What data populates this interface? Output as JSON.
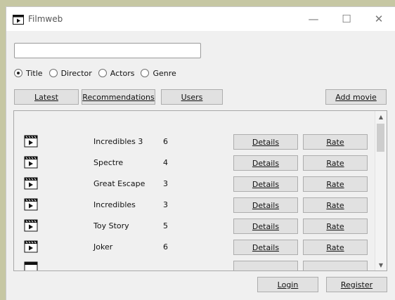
{
  "window": {
    "title": "Filmweb",
    "controls": {
      "minimize": "—",
      "maximize": "☐",
      "close": "✕"
    }
  },
  "search": {
    "value": "",
    "placeholder": ""
  },
  "filters": {
    "options": [
      "Title",
      "Director",
      "Actors",
      "Genre"
    ],
    "selected": "Title"
  },
  "toolbar": {
    "latest": "Latest",
    "recommendations": "Recommendations",
    "users": "Users",
    "add_movie": "Add movie"
  },
  "movies": [
    {
      "title": "Incredibles 3",
      "rating": "6"
    },
    {
      "title": "Spectre",
      "rating": "4"
    },
    {
      "title": "Great Escape",
      "rating": "3"
    },
    {
      "title": "Incredibles",
      "rating": "3"
    },
    {
      "title": "Toy Story",
      "rating": "5"
    },
    {
      "title": "Joker",
      "rating": "6"
    }
  ],
  "row_buttons": {
    "details": "Details",
    "rate": "Rate"
  },
  "footer": {
    "login": "Login",
    "register": "Register"
  },
  "icons": {
    "app": "film-clapper-icon",
    "row": "film-clapper-icon"
  }
}
